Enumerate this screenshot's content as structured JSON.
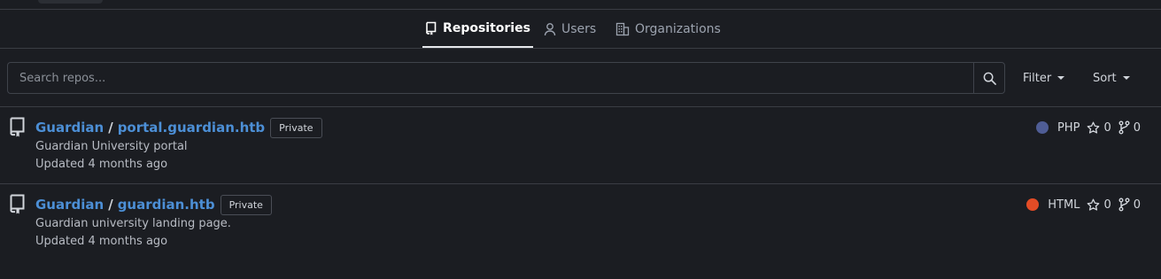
{
  "tabs": [
    {
      "label": "Repositories",
      "icon": "repo-icon",
      "active": true
    },
    {
      "label": "Users",
      "icon": "person-icon",
      "active": false
    },
    {
      "label": "Organizations",
      "icon": "organization-icon",
      "active": false
    }
  ],
  "search": {
    "placeholder": "Search repos...",
    "value": ""
  },
  "filters": {
    "filter_label": "Filter",
    "sort_label": "Sort"
  },
  "repos": [
    {
      "owner": "Guardian",
      "name": "portal.guardian.htb",
      "visibility": "Private",
      "description": "Guardian University portal",
      "updated": "Updated 4 months ago",
      "language": "PHP",
      "language_color": "#4f5d95",
      "stars": "0",
      "forks": "0"
    },
    {
      "owner": "Guardian",
      "name": "guardian.htb",
      "visibility": "Private",
      "description": "Guardian university landing page.",
      "updated": "Updated 4 months ago",
      "language": "HTML",
      "language_color": "#e34c26",
      "stars": "0",
      "forks": "0"
    }
  ],
  "colors": {
    "background": "#1b1d22",
    "link": "#4c8fd6",
    "border": "#3a3d44"
  }
}
